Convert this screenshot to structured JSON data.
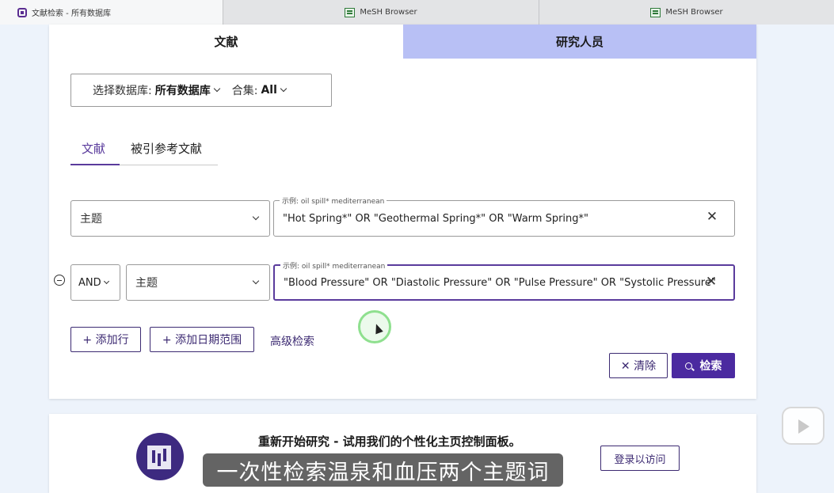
{
  "browser": {
    "tabs": [
      {
        "label": "文献检索 - 所有数据库",
        "active": true
      },
      {
        "label": "MeSH Browser",
        "active": false
      },
      {
        "label": "MeSH Browser",
        "active": false
      }
    ]
  },
  "search_card": {
    "top_tabs": {
      "documents": "文献",
      "researchers": "研究人员"
    },
    "database": {
      "label": "选择数据库:",
      "value": "所有数据库",
      "collection_label": "合集:",
      "collection_value": "All"
    },
    "sub_tabs": {
      "documents": "文献",
      "cited_references": "被引参考文献"
    },
    "rows": [
      {
        "field": "主题",
        "placeholder_hint": "示例: oil spill* mediterranean",
        "query": "\"Hot Spring*\" OR \"Geothermal Spring*\" OR \"Warm Spring*\""
      },
      {
        "operator": "AND",
        "field": "主题",
        "placeholder_hint": "示例: oil spill* mediterranean",
        "query": "\"Blood Pressure\" OR \"Diastolic Pressure\" OR \"Pulse Pressure\" OR \"Systolic Pressure\""
      }
    ],
    "buttons": {
      "add_row": "+ 添加行",
      "add_date_range": "+ 添加日期范围",
      "advanced_search": "高级检索",
      "clear": "✕ 清除",
      "search": "检索"
    }
  },
  "promo": {
    "title": "重新开始研究 - 试用我们的个性化主页控制面板。",
    "login_button": "登录以访问"
  },
  "video_overlay": {
    "subtitle": "一次性检索温泉和血压两个主题词"
  },
  "colors": {
    "accent": "#4b2aa0",
    "researcher_tab": "#b8c0f5",
    "page_bg": "#edf3fb"
  }
}
